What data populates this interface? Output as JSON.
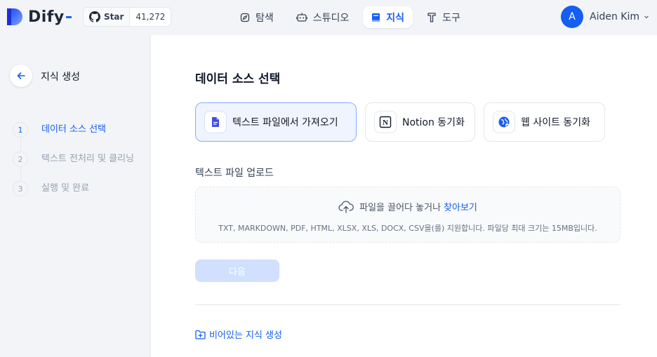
{
  "app": {
    "name": "Dify"
  },
  "github": {
    "star_label": "Star",
    "star_count": "41,272"
  },
  "nav": {
    "explore": "탐색",
    "studio": "스튜디오",
    "knowledge": "지식",
    "tools": "도구"
  },
  "user": {
    "initial": "A",
    "name": "Aiden Kim"
  },
  "sidebar": {
    "title": "지식 생성",
    "steps": [
      {
        "num": "1",
        "label": "데이터 소스 선택"
      },
      {
        "num": "2",
        "label": "텍스트 전처리 및 클리닝"
      },
      {
        "num": "3",
        "label": "실행 및 완료"
      }
    ]
  },
  "main": {
    "title": "데이터 소스 선택",
    "sources": [
      {
        "label": "텍스트 파일에서 가져오기",
        "icon": "file-text-icon"
      },
      {
        "label": "Notion 동기화",
        "icon": "notion-icon"
      },
      {
        "label": "웹 사이트 동기화",
        "icon": "globe-icon"
      }
    ],
    "upload_label": "텍스트 파일 업로드",
    "dropzone": {
      "text": "파일을 끌어다 놓거나",
      "link": "찾아보기",
      "hint": "TXT, MARKDOWN, PDF, HTML, XLSX, XLS, DOCX, CSV을(를) 지원합니다. 파일당 최대 크기는 15MB입니다."
    },
    "next_button": "다음",
    "empty_link": "비어있는 지식 생성"
  },
  "colors": {
    "accent": "#155eef",
    "disabled": "#d1e0ff"
  }
}
